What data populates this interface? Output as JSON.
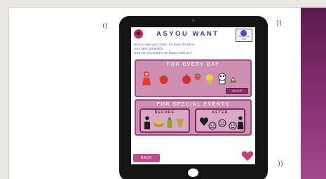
{
  "app": {
    "title": "ASYOU WANT",
    "badge_caption": "NUTRITION APP",
    "welcome_lines": [
      "Nice to see you Claire, it's been 2h since",
      "your last connexion.",
      "How do you want to be happy with us?"
    ]
  },
  "every_day": {
    "title": "FOR EVERY DAY",
    "button_label": "VALIDATE",
    "items": [
      "child-icon",
      "tomato-icon",
      "apple-icon",
      "strawberry-icon",
      "lemon-icon",
      "panda-icon",
      "treat-icon"
    ]
  },
  "special_events": {
    "title": "FOR SPECIAL EVENTS",
    "before_label": "BEFORE",
    "after_label": "AFTER"
  },
  "footer": {
    "button_label": "BACK"
  },
  "colors": {
    "accent": "#c04d8d",
    "card_fill": "#cc8fb2",
    "card_border": "#a84580",
    "title_blue": "#3d3fa8",
    "side_panel": "#7d2a6a"
  }
}
